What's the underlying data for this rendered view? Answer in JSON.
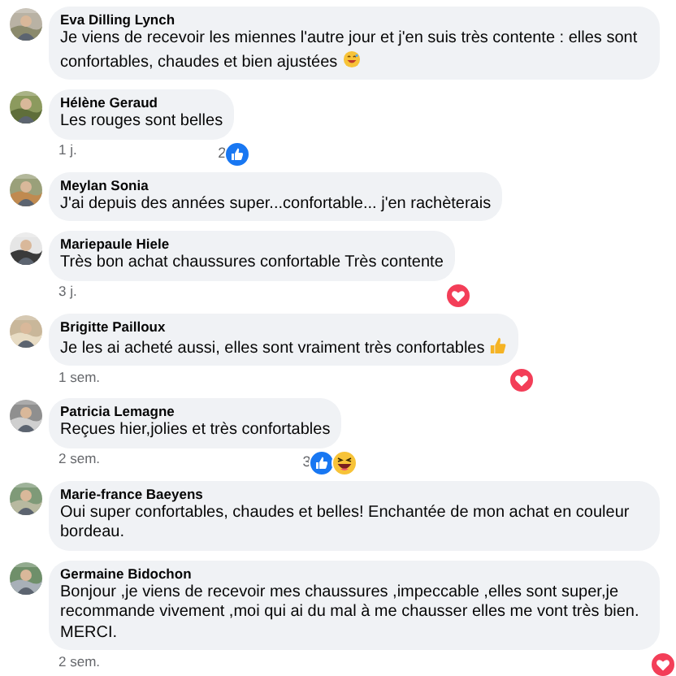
{
  "comments": [
    {
      "author": "Eva Dilling Lynch",
      "text": "Je viens de recevoir les miennes l'autre jour et j'en suis très contente : elles sont confortables, chaudes et bien ajustées",
      "emoji": {
        "kind": "grin"
      }
    },
    {
      "author": "Hélène Geraud",
      "text": "Les rouges sont belles",
      "time": "1 j.",
      "reaction_count": "2",
      "reactions": [
        {
          "kind": "like"
        }
      ]
    },
    {
      "author": "Meylan Sonia",
      "text": "J'ai depuis des années super...confortable... j'en rachèterais"
    },
    {
      "author": "Mariepaule Hiele",
      "text": "Très bon achat chaussures confortable Très contente",
      "time": "3 j.",
      "reactions": [
        {
          "kind": "love"
        }
      ]
    },
    {
      "author": "Brigitte Pailloux",
      "text": "Je les ai acheté aussi, elles sont vraiment très confortables",
      "emoji": {
        "kind": "thumbs-up"
      },
      "time": "1 sem.",
      "reactions": [
        {
          "kind": "love"
        }
      ]
    },
    {
      "author": "Patricia Lemagne",
      "text": "Reçues hier,jolies et très confortables",
      "time": "2 sem.",
      "reaction_count": "3",
      "reactions": [
        {
          "kind": "like"
        },
        {
          "kind": "haha"
        }
      ]
    },
    {
      "author": "Marie-france Baeyens",
      "text": "Oui super confortables, chaudes et belles! Enchantée de mon achat en couleur bordeau."
    },
    {
      "author": "Germaine Bidochon",
      "text": "Bonjour ,je viens de recevoir mes chaussures ,impeccable ,elles sont super,je recommande vivement ,moi qui ai du mal à me chausser elles me vont très bien. MERCI.",
      "time": "2 sem.",
      "reactions": [
        {
          "kind": "love"
        }
      ]
    }
  ]
}
